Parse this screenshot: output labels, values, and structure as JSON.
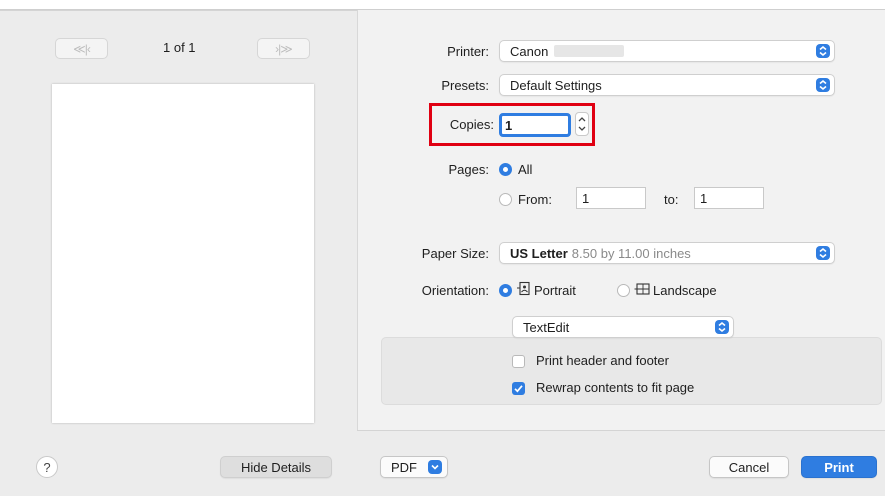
{
  "preview": {
    "first_page_label": "≪|‹",
    "prev_next_label": "›|≫",
    "page_indicator": "1 of 1"
  },
  "printer": {
    "label": "Printer:",
    "value": "Canon"
  },
  "presets": {
    "label": "Presets:",
    "value": "Default Settings"
  },
  "copies": {
    "label": "Copies:",
    "value": "1"
  },
  "pages": {
    "label": "Pages:",
    "all_label": "All",
    "from_label": "From:",
    "from_value": "1",
    "to_label": "to:",
    "to_value": "1",
    "selected": "All"
  },
  "paper_size": {
    "label": "Paper Size:",
    "value": "US Letter",
    "detail": "8.50 by 11.00 inches"
  },
  "orientation": {
    "label": "Orientation:",
    "portrait": "Portrait",
    "landscape": "Landscape",
    "selected": "Portrait"
  },
  "app_section": {
    "popup_value": "TextEdit",
    "print_header_footer": "Print header and footer",
    "print_header_footer_checked": false,
    "rewrap": "Rewrap contents to fit page",
    "rewrap_checked": true
  },
  "footer": {
    "help_label": "?",
    "hide_details": "Hide Details",
    "pdf": "PDF",
    "cancel": "Cancel",
    "print": "Print"
  },
  "colors": {
    "accent": "#2f7de1",
    "highlight": "#e00012"
  }
}
